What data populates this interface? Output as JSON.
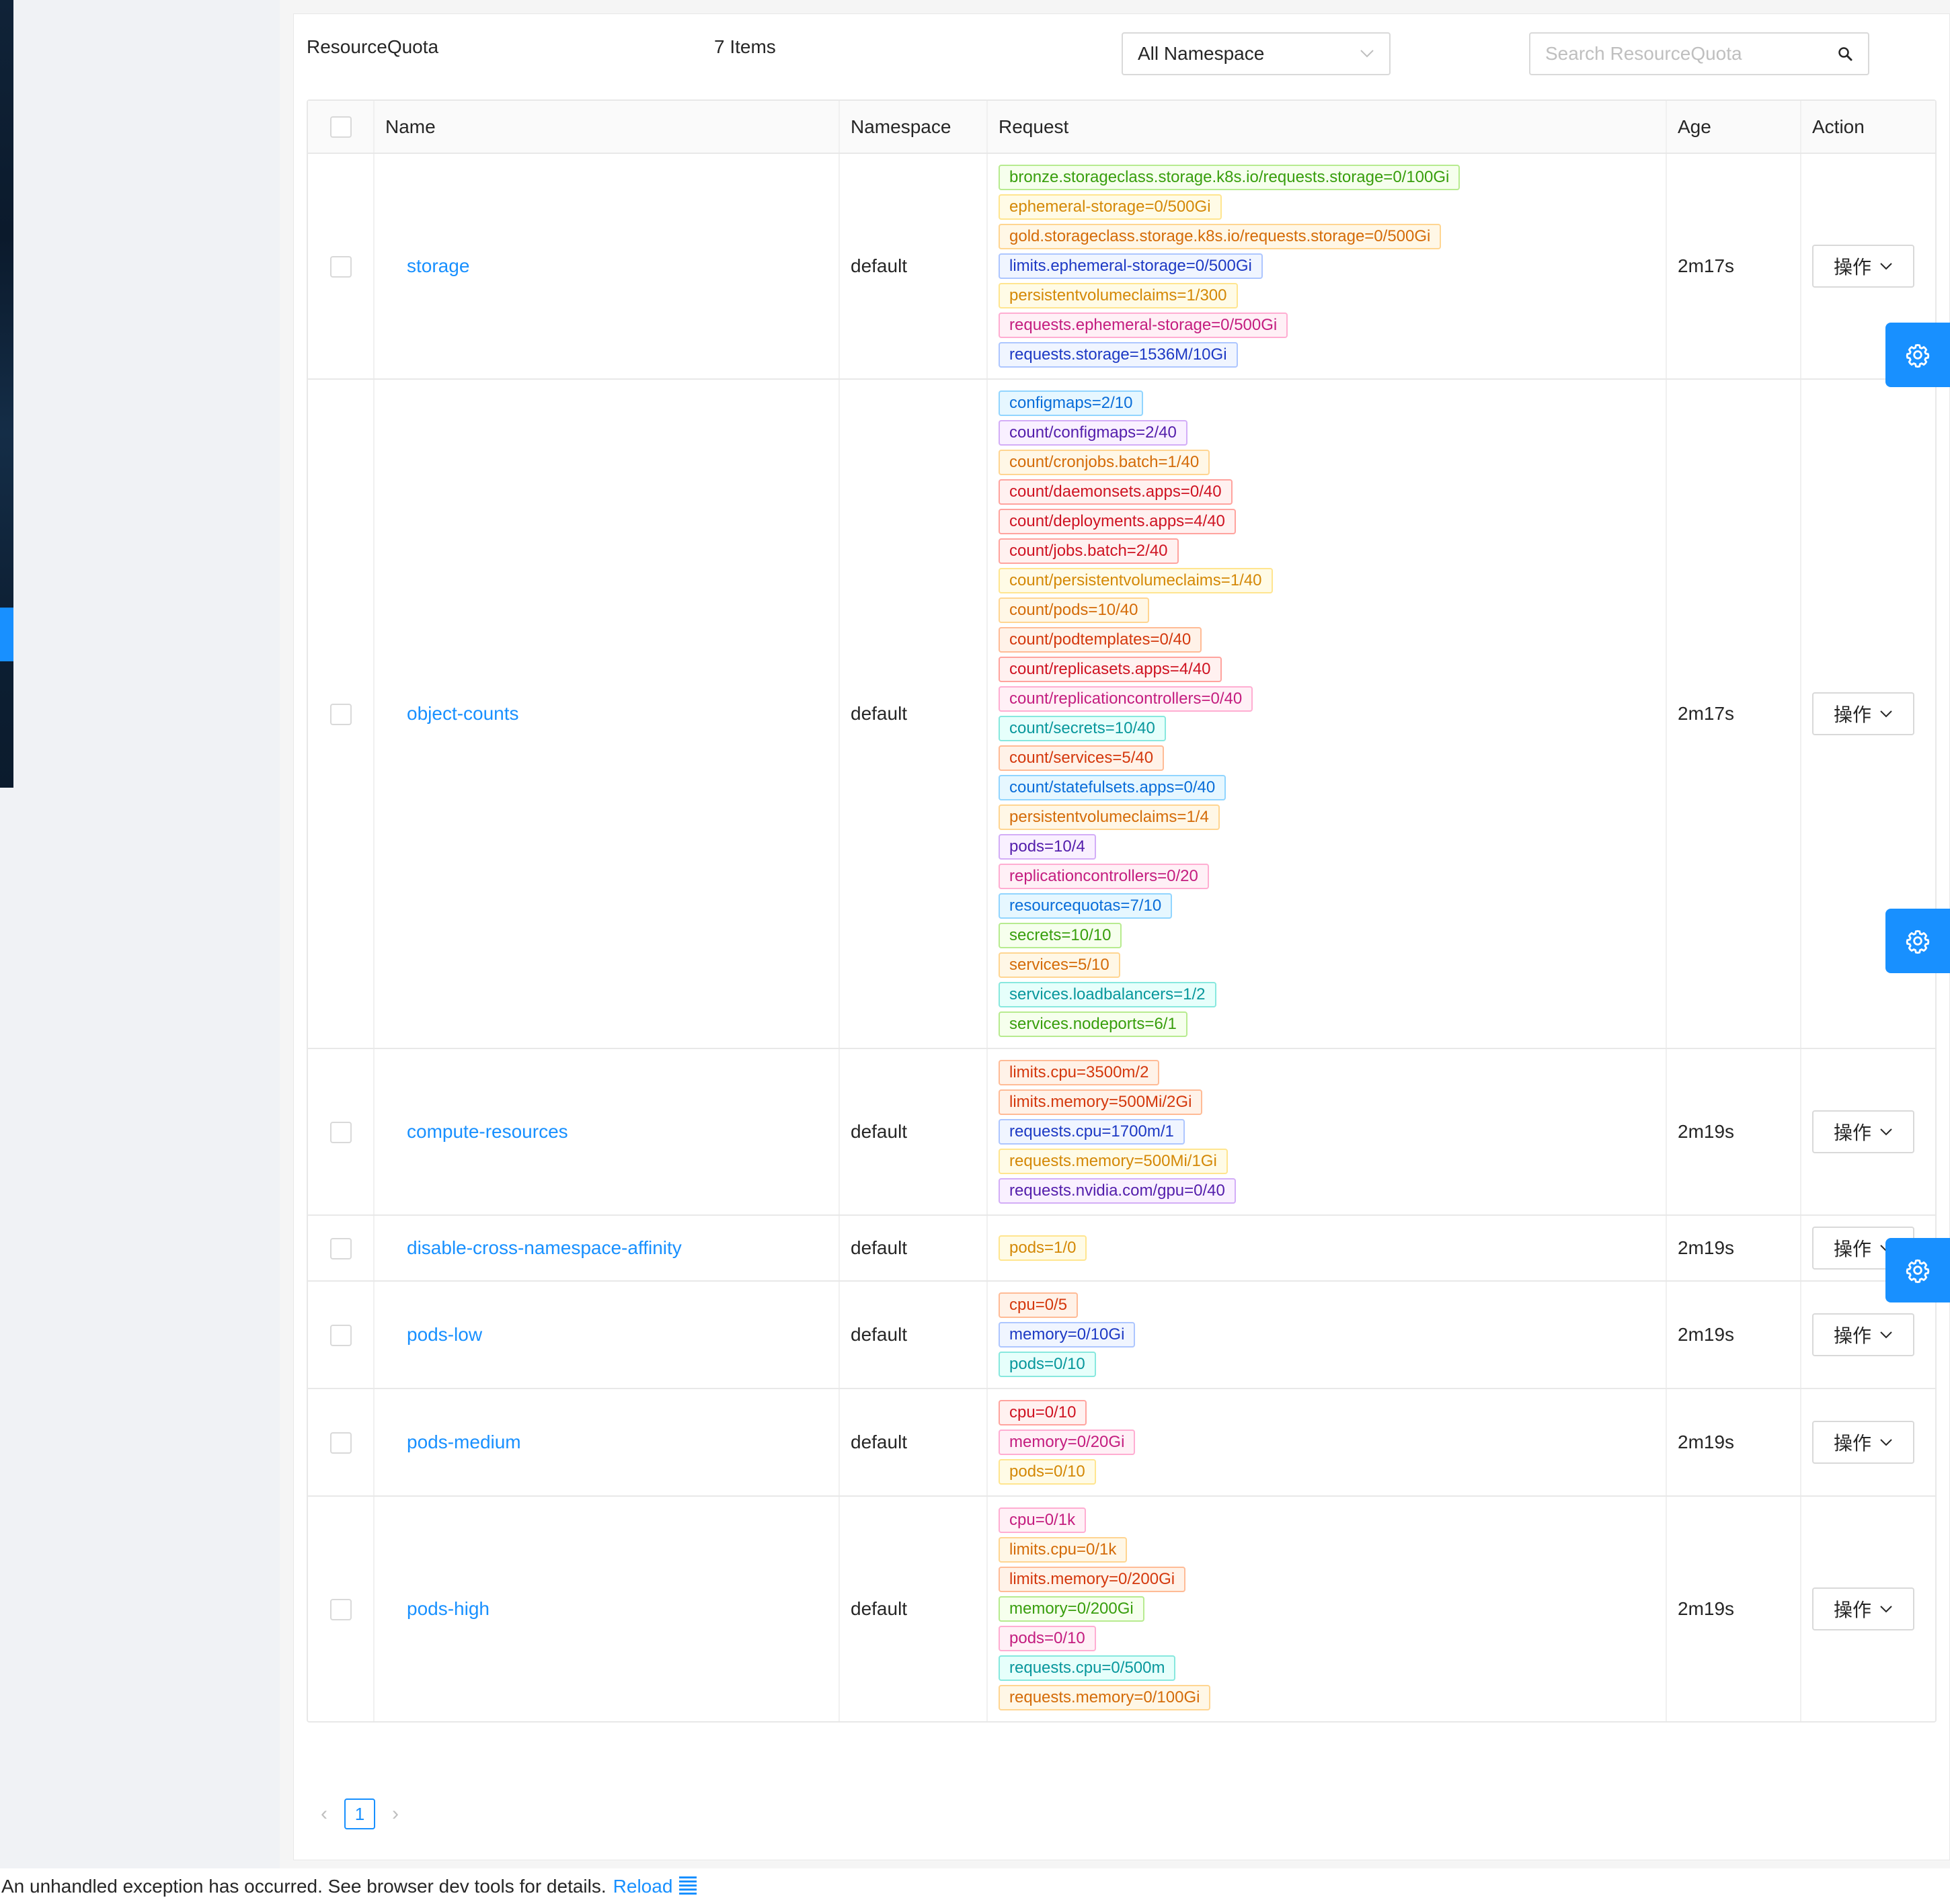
{
  "header": {
    "title": "ResourceQuota",
    "count": "7 Items",
    "namespace_select": "All Namespace",
    "search_placeholder": "Search ResourceQuota"
  },
  "columns": {
    "name": "Name",
    "namespace": "Namespace",
    "request": "Request",
    "age": "Age",
    "action": "Action"
  },
  "rows": [
    {
      "name": "storage",
      "namespace": "default",
      "age": "2m17s",
      "action": "操作",
      "requests": [
        {
          "text": "bronze.storageclass.storage.k8s.io/requests.storage=0/100Gi",
          "color": "green"
        },
        {
          "text": "ephemeral-storage=0/500Gi",
          "color": "gold"
        },
        {
          "text": "gold.storageclass.storage.k8s.io/requests.storage=0/500Gi",
          "color": "orange"
        },
        {
          "text": "limits.ephemeral-storage=0/500Gi",
          "color": "geekblue"
        },
        {
          "text": "persistentvolumeclaims=1/300",
          "color": "gold"
        },
        {
          "text": "requests.ephemeral-storage=0/500Gi",
          "color": "magenta"
        },
        {
          "text": "requests.storage=1536M/10Gi",
          "color": "geekblue"
        }
      ]
    },
    {
      "name": "object-counts",
      "namespace": "default",
      "age": "2m17s",
      "action": "操作",
      "requests": [
        {
          "text": "configmaps=2/10",
          "color": "blue"
        },
        {
          "text": "count/configmaps=2/40",
          "color": "purple"
        },
        {
          "text": "count/cronjobs.batch=1/40",
          "color": "orange"
        },
        {
          "text": "count/daemonsets.apps=0/40",
          "color": "red"
        },
        {
          "text": "count/deployments.apps=4/40",
          "color": "red"
        },
        {
          "text": "count/jobs.batch=2/40",
          "color": "red"
        },
        {
          "text": "count/persistentvolumeclaims=1/40",
          "color": "gold"
        },
        {
          "text": "count/pods=10/40",
          "color": "orange"
        },
        {
          "text": "count/podtemplates=0/40",
          "color": "volcano"
        },
        {
          "text": "count/replicasets.apps=4/40",
          "color": "red"
        },
        {
          "text": "count/replicationcontrollers=0/40",
          "color": "magenta"
        },
        {
          "text": "count/secrets=10/40",
          "color": "cyan"
        },
        {
          "text": "count/services=5/40",
          "color": "volcano"
        },
        {
          "text": "count/statefulsets.apps=0/40",
          "color": "blue"
        },
        {
          "text": "persistentvolumeclaims=1/4",
          "color": "orange"
        },
        {
          "text": "pods=10/4",
          "color": "purple"
        },
        {
          "text": "replicationcontrollers=0/20",
          "color": "magenta"
        },
        {
          "text": "resourcequotas=7/10",
          "color": "blue"
        },
        {
          "text": "secrets=10/10",
          "color": "green"
        },
        {
          "text": "services=5/10",
          "color": "orange"
        },
        {
          "text": "services.loadbalancers=1/2",
          "color": "cyan"
        },
        {
          "text": "services.nodeports=6/1",
          "color": "green"
        }
      ]
    },
    {
      "name": "compute-resources",
      "namespace": "default",
      "age": "2m19s",
      "action": "操作",
      "requests": [
        {
          "text": "limits.cpu=3500m/2",
          "color": "volcano"
        },
        {
          "text": "limits.memory=500Mi/2Gi",
          "color": "volcano"
        },
        {
          "text": "requests.cpu=1700m/1",
          "color": "geekblue"
        },
        {
          "text": "requests.memory=500Mi/1Gi",
          "color": "gold"
        },
        {
          "text": "requests.nvidia.com/gpu=0/40",
          "color": "purple"
        }
      ]
    },
    {
      "name": "disable-cross-namespace-affinity",
      "namespace": "default",
      "age": "2m19s",
      "action": "操作",
      "requests": [
        {
          "text": "pods=1/0",
          "color": "gold"
        }
      ]
    },
    {
      "name": "pods-low",
      "namespace": "default",
      "age": "2m19s",
      "action": "操作",
      "requests": [
        {
          "text": "cpu=0/5",
          "color": "volcano"
        },
        {
          "text": "memory=0/10Gi",
          "color": "geekblue"
        },
        {
          "text": "pods=0/10",
          "color": "cyan"
        }
      ]
    },
    {
      "name": "pods-medium",
      "namespace": "default",
      "age": "2m19s",
      "action": "操作",
      "requests": [
        {
          "text": "cpu=0/10",
          "color": "red"
        },
        {
          "text": "memory=0/20Gi",
          "color": "magenta"
        },
        {
          "text": "pods=0/10",
          "color": "gold"
        }
      ]
    },
    {
      "name": "pods-high",
      "namespace": "default",
      "age": "2m19s",
      "action": "操作",
      "requests": [
        {
          "text": "cpu=0/1k",
          "color": "magenta"
        },
        {
          "text": "limits.cpu=0/1k",
          "color": "orange"
        },
        {
          "text": "limits.memory=0/200Gi",
          "color": "volcano"
        },
        {
          "text": "memory=0/200Gi",
          "color": "green"
        },
        {
          "text": "pods=0/10",
          "color": "magenta"
        },
        {
          "text": "requests.cpu=0/500m",
          "color": "cyan"
        },
        {
          "text": "requests.memory=0/100Gi",
          "color": "orange"
        }
      ]
    }
  ],
  "pagination": {
    "current_page": "1",
    "prev_icon": "chevron-left-icon",
    "next_icon": "chevron-right-icon"
  },
  "error_bar": {
    "message": "An unhandled exception has occurred. See browser dev tools for details.",
    "reload": "Reload",
    "dismiss_icon": "menu-lines-icon"
  },
  "floating_buttons": [
    {
      "icon": "gear-icon"
    },
    {
      "icon": "gear-icon"
    },
    {
      "icon": "gear-icon"
    }
  ],
  "colors": {
    "accent": "#1890ff",
    "sider_dark": "#0b1a2c",
    "tag_green": "#389e0d",
    "tag_gold": "#d48806",
    "tag_orange": "#d46b08",
    "tag_geekblue": "#1d39c4",
    "tag_magenta": "#c41d7f",
    "tag_blue": "#096dd9",
    "tag_purple": "#531dab",
    "tag_red": "#cf1322",
    "tag_volcano": "#d4380d",
    "tag_cyan": "#08979c"
  }
}
